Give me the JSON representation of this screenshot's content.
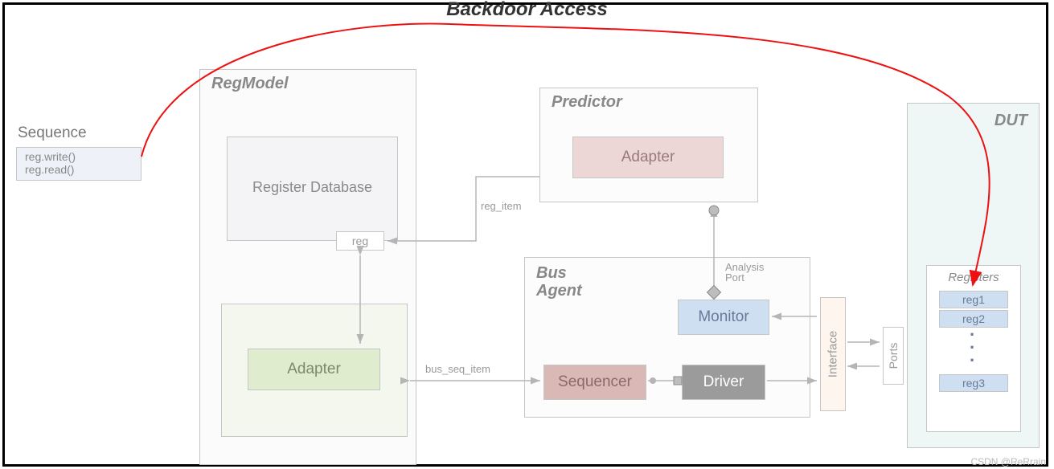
{
  "title": "Backdoor Access",
  "watermark": "CSDN @ReRrain",
  "sequence": {
    "title": "Sequence",
    "lines": [
      "reg.write()",
      "reg.read()"
    ]
  },
  "regmodel": {
    "title": "RegModel",
    "regdb": "Register Database",
    "reg_port": "reg",
    "adapter": "Adapter"
  },
  "predictor": {
    "title": "Predictor",
    "adapter": "Adapter"
  },
  "bus_agent": {
    "title_line1": "Bus",
    "title_line2": "Agent",
    "monitor": "Monitor",
    "sequencer": "Sequencer",
    "driver": "Driver",
    "analysis_port": "Analysis\nPort"
  },
  "labels": {
    "reg_item": "reg_item",
    "bus_seq_item": "bus_seq_item"
  },
  "interface": "Interface",
  "ports": "Ports",
  "dut": {
    "title": "DUT",
    "registers_title": "Registers",
    "regs": [
      "reg1",
      "reg2",
      "reg3"
    ]
  }
}
